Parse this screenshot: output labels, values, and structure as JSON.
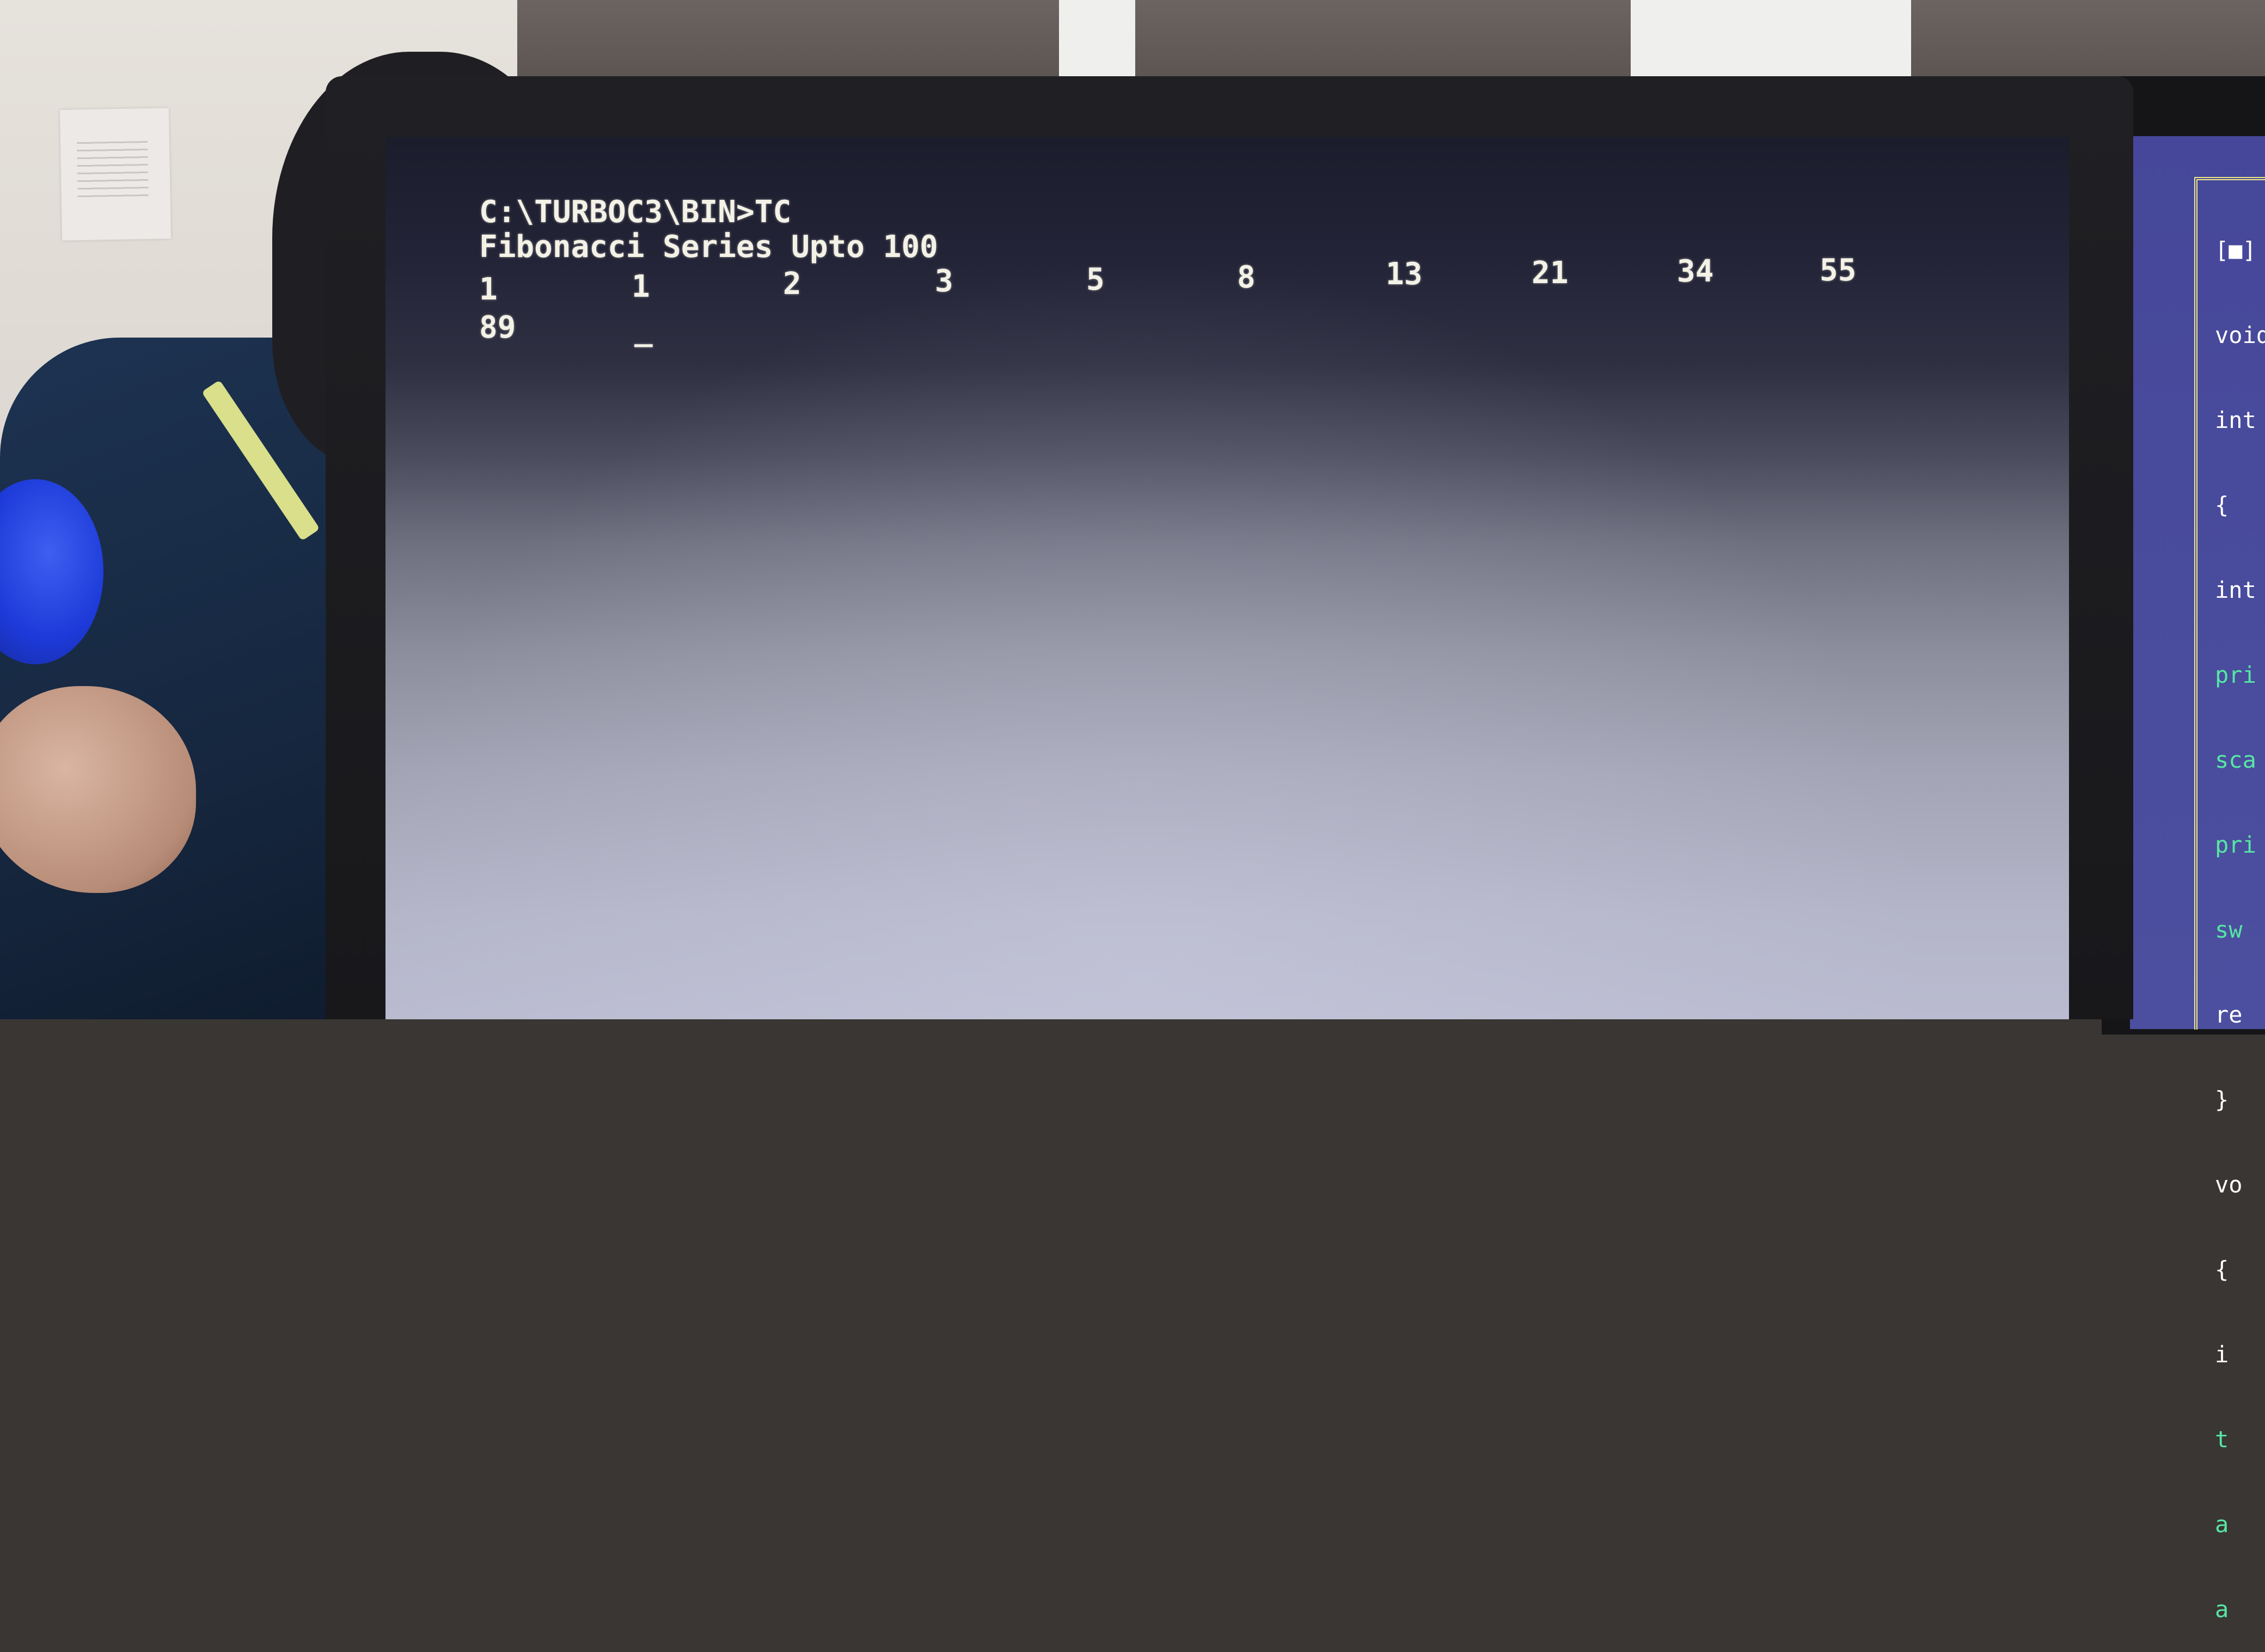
{
  "terminal": {
    "prompt": "C:\\TURBOC3\\BIN>TC",
    "title": "Fibonacci Series Upto 100",
    "row1": [
      "1",
      "1",
      "2",
      "3",
      "5",
      "8",
      "13",
      "21",
      "34",
      "55"
    ],
    "row2": "89",
    "cursor": "_"
  },
  "side_monitor": {
    "code_lines": [
      "[■]",
      "void",
      "int",
      "{",
      "int",
      "pri",
      "sca",
      "pri",
      "sw",
      "re",
      "}",
      "vo",
      "{",
      "i",
      "t",
      "a",
      "a"
    ]
  },
  "colors": {
    "terminal_text": "#f4f1e6",
    "ide_background": "#46479a",
    "ide_border": "#f0ea86",
    "ide_keyword": "#56e6a4"
  }
}
